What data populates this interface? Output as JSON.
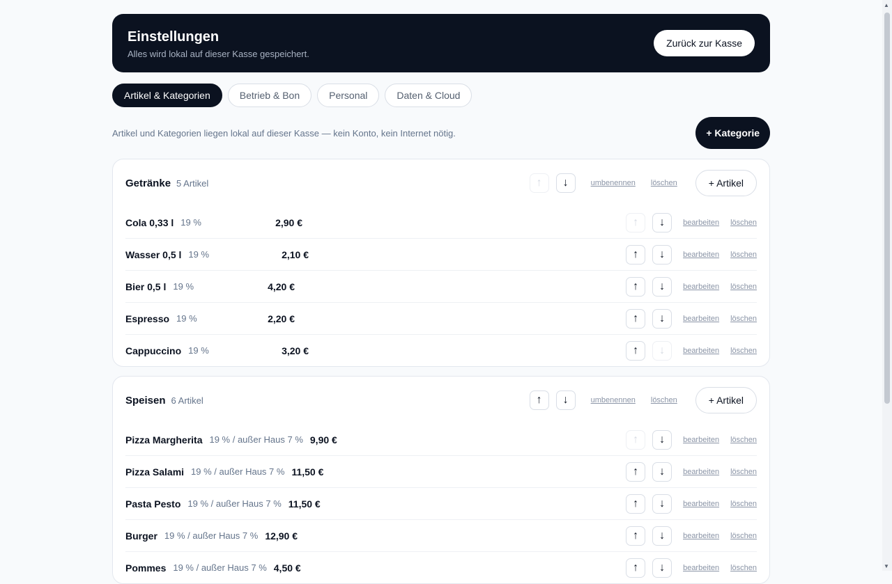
{
  "header": {
    "title": "Einstellungen",
    "subtitle": "Alles wird lokal auf dieser Kasse gespeichert.",
    "back_label": "Zurück zur Kasse"
  },
  "tabs": [
    {
      "label": "Artikel & Kategorien",
      "active": true
    },
    {
      "label": "Betrieb & Bon",
      "active": false
    },
    {
      "label": "Personal",
      "active": false
    },
    {
      "label": "Daten & Cloud",
      "active": false
    }
  ],
  "info": {
    "text": "Artikel und Kategorien liegen lokal auf dieser Kasse — kein Konto, kein Internet nötig.",
    "add_category_label": "+ Kategorie"
  },
  "labels": {
    "rename": "umbenennen",
    "delete": "löschen",
    "edit": "bearbeiten",
    "add_article": "+ Artikel",
    "arrow_up": "↑",
    "arrow_down": "↓"
  },
  "categories": [
    {
      "name": "Getränke",
      "count": "5 Artikel",
      "up_enabled": false,
      "down_enabled": true,
      "items": [
        {
          "name": "Cola 0,33 l",
          "tax": "19 %",
          "price": "2,90 €"
        },
        {
          "name": "Wasser 0,5 l",
          "tax": "19 %",
          "price": "2,10 €"
        },
        {
          "name": "Bier 0,5 l",
          "tax": "19 %",
          "price": "4,20 €"
        },
        {
          "name": "Espresso",
          "tax": "19 %",
          "price": "2,20 €"
        },
        {
          "name": "Cappuccino",
          "tax": "19 %",
          "price": "3,20 €"
        }
      ]
    },
    {
      "name": "Speisen",
      "count": "6 Artikel",
      "up_enabled": true,
      "down_enabled": true,
      "items": [
        {
          "name": "Pizza Margherita",
          "tax": "19 % / außer Haus 7 %",
          "price": "9,90 €"
        },
        {
          "name": "Pizza Salami",
          "tax": "19 % / außer Haus 7 %",
          "price": "11,50 €"
        },
        {
          "name": "Pasta Pesto",
          "tax": "19 % / außer Haus 7 %",
          "price": "11,50 €"
        },
        {
          "name": "Burger",
          "tax": "19 % / außer Haus 7 %",
          "price": "12,90 €"
        },
        {
          "name": "Pommes",
          "tax": "19 % / außer Haus 7 %",
          "price": "4,50 €"
        }
      ]
    }
  ]
}
